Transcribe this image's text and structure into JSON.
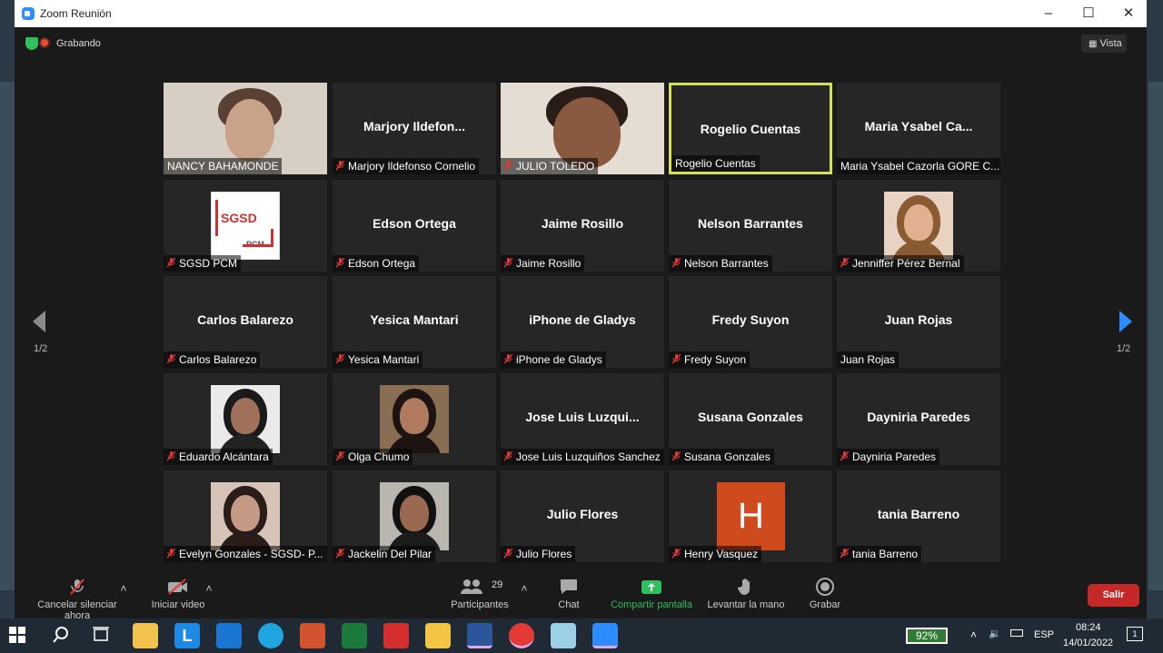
{
  "window": {
    "title": "Zoom Reunión"
  },
  "status": {
    "recording": "Grabando",
    "view": "Vista"
  },
  "pagination": {
    "left": "1/2",
    "right": "1/2"
  },
  "tiles": [
    {
      "big": "",
      "name": "NANCY BAHAMONDE",
      "muted": false,
      "kind": "photo"
    },
    {
      "big": "Marjory  Ildefon...",
      "name": "Marjory Ildefonso Cornelio",
      "muted": true
    },
    {
      "big": "",
      "name": "JULIO TOLEDO",
      "muted": true,
      "kind": "photo"
    },
    {
      "big": "Rogelio Cuentas",
      "name": "Rogelio Cuentas",
      "muted": false,
      "active": true
    },
    {
      "big": "Maria  Ysabel  Ca...",
      "name": "Maria Ysabel Cazorla GORE C...",
      "muted": false
    },
    {
      "big": "",
      "name": "SGSD PCM",
      "muted": true,
      "kind": "logo"
    },
    {
      "big": "Edson Ortega",
      "name": "Edson Ortega",
      "muted": true
    },
    {
      "big": "Jaime Rosillo",
      "name": "Jaime Rosillo",
      "muted": true
    },
    {
      "big": "Nelson Barrantes",
      "name": "Nelson Barrantes",
      "muted": true
    },
    {
      "big": "",
      "name": "Jenniffer Pérez Bernal",
      "muted": true,
      "kind": "avatar"
    },
    {
      "big": "Carlos Balarezo",
      "name": "Carlos Balarezo",
      "muted": true
    },
    {
      "big": "Yesica Mantari",
      "name": "Yesica Mantari",
      "muted": true
    },
    {
      "big": "iPhone de Gladys",
      "name": "iPhone de Gladys",
      "muted": true
    },
    {
      "big": "Fredy Suyon",
      "name": "Fredy Suyon",
      "muted": true
    },
    {
      "big": "Juan Rojas",
      "name": "Juan Rojas",
      "muted": false
    },
    {
      "big": "",
      "name": "Eduardo Alcántara",
      "muted": true,
      "kind": "avatar"
    },
    {
      "big": "",
      "name": "Olga Chumo",
      "muted": true,
      "kind": "avatar"
    },
    {
      "big": "Jose  Luis  Luzqui...",
      "name": "Jose Luis Luzquiños Sanchez",
      "muted": true
    },
    {
      "big": "Susana Gonzales",
      "name": "Susana Gonzales",
      "muted": true
    },
    {
      "big": "Dayniria Paredes",
      "name": "Dayniria Paredes",
      "muted": true
    },
    {
      "big": "",
      "name": "Evelyn Gonzales - SGSD- P...",
      "muted": true,
      "kind": "avatar"
    },
    {
      "big": "",
      "name": "Jackelin Del Pilar",
      "muted": true,
      "kind": "avatar"
    },
    {
      "big": "Julio Flores",
      "name": "Julio Flores",
      "muted": true
    },
    {
      "big": "",
      "name": "Henry Vasquez",
      "muted": true,
      "kind": "letter",
      "letter": "H"
    },
    {
      "big": "tania Barreno",
      "name": "tania Barreno",
      "muted": true
    }
  ],
  "sgsd_logo": {
    "line1": "SGSD",
    "line2": "PCM"
  },
  "toolbar": {
    "unmute": "Cancelar silenciar ahora",
    "video": "Iniciar video",
    "participants": "Participantes",
    "participants_count": "29",
    "chat": "Chat",
    "share": "Compartir pantalla",
    "raise": "Levantar la mano",
    "record": "Grabar",
    "leave": "Salir"
  },
  "taskbar": {
    "battery": "92%",
    "lang": "ESP",
    "time": "08:24",
    "date": "14/01/2022",
    "notif": "1"
  },
  "colors": {
    "accent": "#2d8cff",
    "active_speaker": "#d4e157",
    "leave": "#c62828",
    "share": "#2fbf5f"
  }
}
